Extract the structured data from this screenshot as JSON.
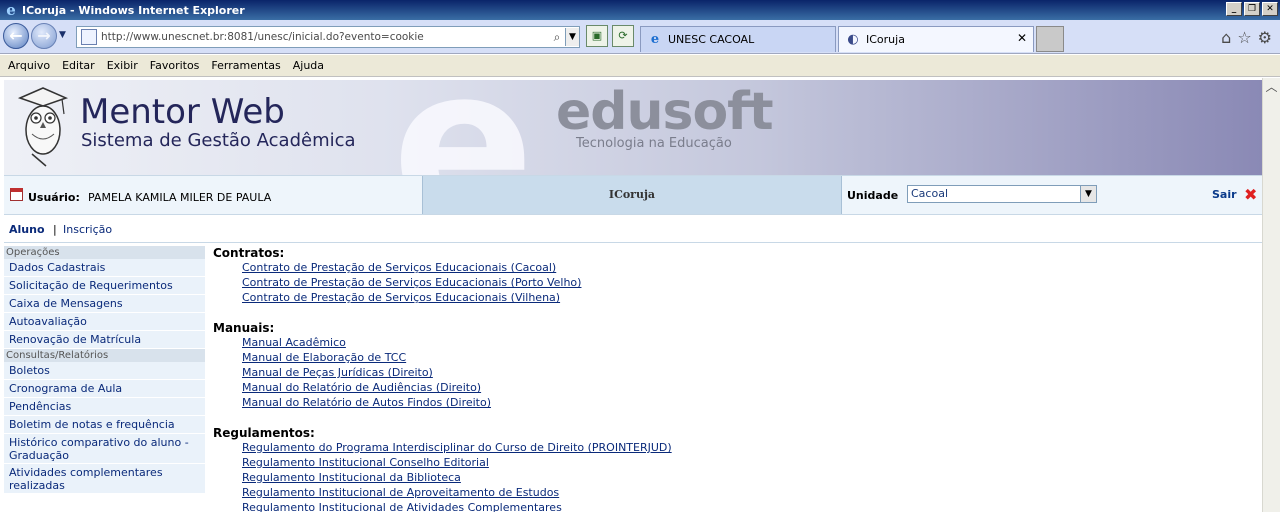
{
  "window": {
    "title": "ICoruja - Windows Internet Explorer"
  },
  "browser": {
    "url": "http://www.unescnet.br:8081/unesc/inicial.do?evento=cookie",
    "tabs": [
      {
        "label": "UNESC CACOAL",
        "active": false
      },
      {
        "label": "ICoruja",
        "active": true
      }
    ]
  },
  "menu": [
    "Arquivo",
    "Editar",
    "Exibir",
    "Favoritos",
    "Ferramentas",
    "Ajuda"
  ],
  "banner": {
    "title": "Mentor Web",
    "subtitle": "Sistema de Gestão Acadêmica",
    "brand": "edusoft",
    "tagline": "Tecnologia na Educação"
  },
  "userbar": {
    "user_label": "Usuário:",
    "user_name": "PAMELA KAMILA MILER DE PAULA",
    "center_title": "ICoruja",
    "unit_label": "Unidade",
    "unit_value": "Cacoal",
    "logout": "Sair"
  },
  "toptabs": {
    "aluno": "Aluno",
    "sep": "|",
    "inscricao": "Inscrição"
  },
  "sidebar": {
    "operacoes": {
      "title": "Operações",
      "items": [
        "Dados Cadastrais",
        "Solicitação de Requerimentos",
        "Caixa de Mensagens",
        "Autoavaliação",
        "Renovação de Matrícula"
      ]
    },
    "consultas": {
      "title": "Consultas/Relatórios",
      "items": [
        "Boletos",
        "Cronograma de Aula",
        "Pendências",
        "Boletim de notas e frequência",
        "Histórico comparativo do aluno - Graduação",
        "Atividades complementares realizadas"
      ]
    }
  },
  "content": {
    "contratos": {
      "title": "Contratos:",
      "links": [
        "Contrato de Prestação de Serviços Educacionais (Cacoal)",
        "Contrato de Prestação de Serviços Educacionais (Porto Velho)",
        "Contrato de Prestação de Serviços Educacionais (Vilhena)"
      ]
    },
    "manuais": {
      "title": "Manuais:",
      "links": [
        "Manual Acadêmico",
        "Manual de Elaboração de TCC",
        "Manual de Peças Jurídicas (Direito)",
        "Manual do Relatório de Audiências (Direito)",
        "Manual do Relatório de Autos Findos (Direito)"
      ]
    },
    "regulamentos": {
      "title": "Regulamentos:",
      "links": [
        "Regulamento do Programa Interdisciplinar do Curso de Direito (PROINTERJUD)",
        "Regulamento Institucional Conselho Editorial",
        "Regulamento Institucional da Biblioteca",
        "Regulamento Institucional de Aproveitamento de Estudos",
        "Regulamento Institucional de Atividades Complementares"
      ]
    }
  }
}
